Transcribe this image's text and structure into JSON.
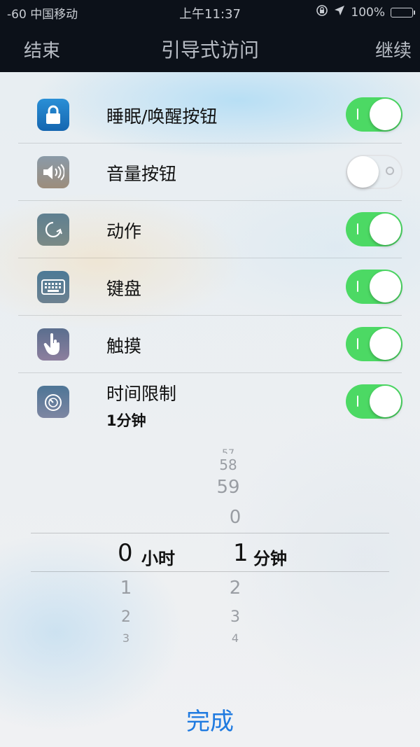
{
  "status_bar": {
    "signal": "-60",
    "carrier": "中国移动",
    "time": "上午11:37",
    "battery": "100%",
    "battery_color": "#4cd964"
  },
  "nav": {
    "left": "结束",
    "title": "引导式访问",
    "right": "继续"
  },
  "options": [
    {
      "label": "睡眠/唤醒按钮",
      "icon": "lock-icon",
      "on": true
    },
    {
      "label": "音量按钮",
      "icon": "speaker-icon",
      "on": false
    },
    {
      "label": "动作",
      "icon": "rotate-icon",
      "on": true
    },
    {
      "label": "键盘",
      "icon": "keyboard-icon",
      "on": true
    },
    {
      "label": "触摸",
      "icon": "hand-touch-icon",
      "on": true
    },
    {
      "label": "时间限制",
      "sublabel": "1分钟",
      "icon": "timer-icon",
      "on": true
    }
  ],
  "picker": {
    "hours": {
      "above": [],
      "selected": "0",
      "unit": "小时",
      "below": [
        "1",
        "2",
        "3"
      ]
    },
    "minutes": {
      "above": [
        "57",
        "58",
        "59",
        "0"
      ],
      "selected": "1",
      "unit": "分钟",
      "below": [
        "2",
        "3",
        "4"
      ]
    }
  },
  "done_label": "完成",
  "colors": {
    "toggle_on": "#4cd964",
    "accent": "#1f7ae0"
  }
}
